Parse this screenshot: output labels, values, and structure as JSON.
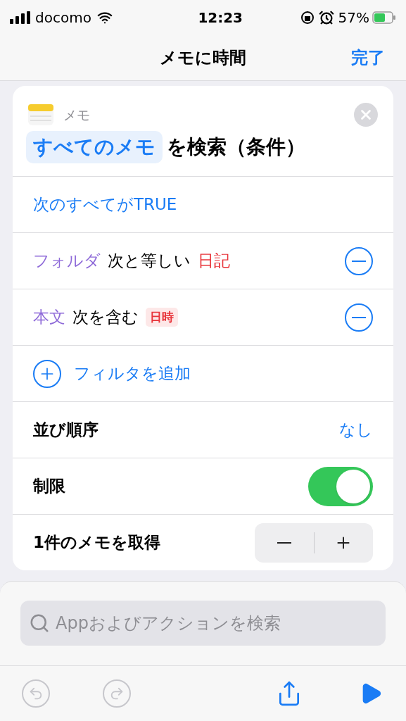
{
  "status_bar": {
    "carrier": "docomo",
    "time": "12:23",
    "battery": "57%"
  },
  "nav": {
    "title": "メモに時間",
    "done": "完了"
  },
  "action": {
    "app": "メモ",
    "token": "すべてのメモ",
    "title_rest": "を検索（条件）"
  },
  "rows": [
    {
      "kind": "match",
      "text": "次のすべてがTRUE"
    },
    {
      "kind": "filter",
      "property": "フォルダ",
      "operator": "次と等しい",
      "value": {
        "kind": "plain",
        "text": "日記"
      }
    },
    {
      "kind": "filter",
      "property": "本文",
      "operator": "次を含む",
      "value": {
        "kind": "variable",
        "text": "日時"
      }
    },
    {
      "kind": "add",
      "text": "フィルタを追加"
    },
    {
      "kind": "setting",
      "label": "並び順序",
      "value": "なし"
    },
    {
      "kind": "toggle",
      "label": "制限",
      "on": true
    },
    {
      "kind": "stepper",
      "label": "1件のメモを取得"
    }
  ],
  "search": {
    "placeholder": "Appおよびアクションを検索"
  },
  "toolbar": [
    {
      "kind": "undo",
      "disabled": true
    },
    {
      "kind": "redo",
      "disabled": true
    },
    {
      "kind": "share",
      "disabled": false
    },
    {
      "kind": "play",
      "disabled": false
    }
  ]
}
